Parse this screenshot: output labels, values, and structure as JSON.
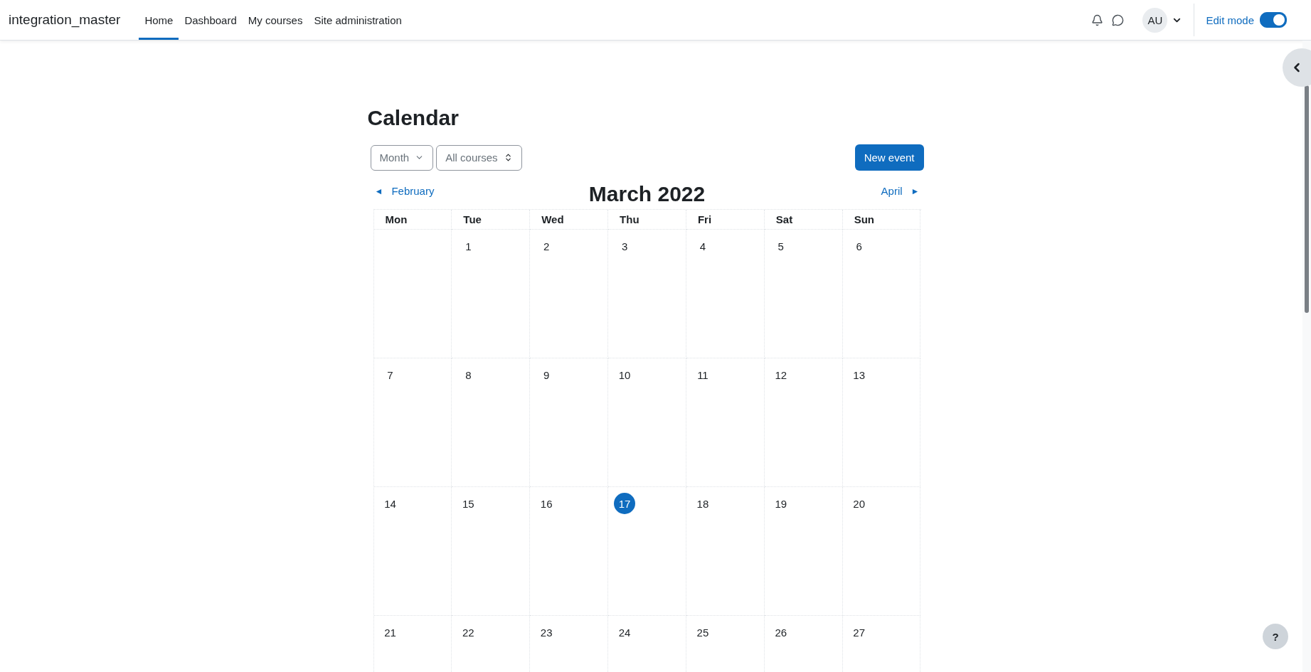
{
  "navbar": {
    "site_name": "integration_master",
    "links": [
      {
        "label": "Home",
        "selected": true
      },
      {
        "label": "Dashboard",
        "selected": false
      },
      {
        "label": "My courses",
        "selected": false
      },
      {
        "label": "Site administration",
        "selected": false
      }
    ],
    "avatar": "AU",
    "edit_mode": {
      "label": "Edit mode",
      "on": true
    }
  },
  "calendar": {
    "title": "Calendar",
    "view_select": "Month",
    "course_select": "All courses",
    "new_event": "New event",
    "prev": {
      "arrow": "◄",
      "label": "February"
    },
    "month": "March 2022",
    "next": {
      "label": "April",
      "arrow": "►"
    },
    "weekdays": [
      "Mon",
      "Tue",
      "Wed",
      "Thu",
      "Fri",
      "Sat",
      "Sun"
    ],
    "weeks": [
      [
        {
          "kind": "empty"
        },
        {
          "kind": "day",
          "label": "1",
          "today": false
        },
        {
          "kind": "day",
          "label": "2",
          "today": false
        },
        {
          "kind": "day",
          "label": "3",
          "today": false
        },
        {
          "kind": "day",
          "label": "4",
          "today": false
        },
        {
          "kind": "day",
          "label": "5",
          "today": false
        },
        {
          "kind": "day",
          "label": "6",
          "today": false
        }
      ],
      [
        {
          "kind": "day",
          "label": "7",
          "today": false
        },
        {
          "kind": "day",
          "label": "8",
          "today": false
        },
        {
          "kind": "day",
          "label": "9",
          "today": false
        },
        {
          "kind": "day",
          "label": "10",
          "today": false
        },
        {
          "kind": "day",
          "label": "11",
          "today": false
        },
        {
          "kind": "day",
          "label": "12",
          "today": false
        },
        {
          "kind": "day",
          "label": "13",
          "today": false
        }
      ],
      [
        {
          "kind": "day",
          "label": "14",
          "today": false
        },
        {
          "kind": "day",
          "label": "15",
          "today": false
        },
        {
          "kind": "day",
          "label": "16",
          "today": false
        },
        {
          "kind": "day",
          "label": "17",
          "today": true
        },
        {
          "kind": "day",
          "label": "18",
          "today": false
        },
        {
          "kind": "day",
          "label": "19",
          "today": false
        },
        {
          "kind": "day",
          "label": "20",
          "today": false
        }
      ],
      [
        {
          "kind": "day",
          "label": "21",
          "today": false
        },
        {
          "kind": "day",
          "label": "22",
          "today": false
        },
        {
          "kind": "day",
          "label": "23",
          "today": false
        },
        {
          "kind": "day",
          "label": "24",
          "today": false
        },
        {
          "kind": "day",
          "label": "25",
          "today": false
        },
        {
          "kind": "day",
          "label": "26",
          "today": false
        },
        {
          "kind": "day",
          "label": "27",
          "today": false
        }
      ]
    ]
  },
  "help_button": "?"
}
